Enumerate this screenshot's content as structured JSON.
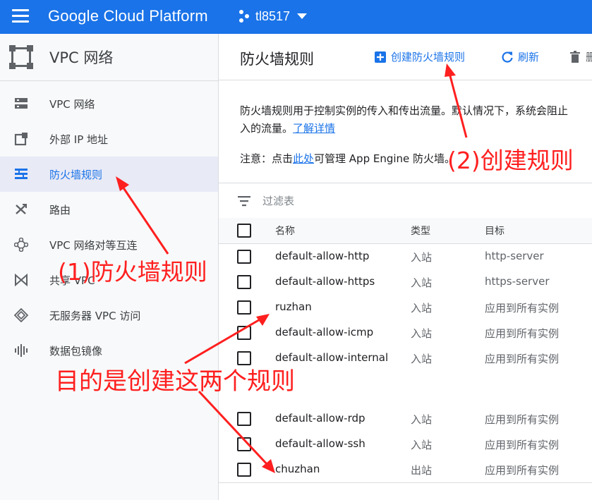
{
  "topbar": {
    "app_title": "Google Cloud Platform",
    "project_name": "tl8517",
    "color": "#1a73e8"
  },
  "sidebar": {
    "title": "VPC 网络",
    "items": [
      {
        "label": "VPC 网络",
        "icon": "vpc-network-icon",
        "active": false
      },
      {
        "label": "外部 IP 地址",
        "icon": "external-ip-icon",
        "active": false
      },
      {
        "label": "防火墙规则",
        "icon": "firewall-icon",
        "active": true
      },
      {
        "label": "路由",
        "icon": "routes-icon",
        "active": false
      },
      {
        "label": "VPC 网络对等互连",
        "icon": "peering-icon",
        "active": false
      },
      {
        "label": "共享 VPC",
        "icon": "shared-vpc-icon",
        "active": false
      },
      {
        "label": "无服务器 VPC 访问",
        "icon": "serverless-icon",
        "active": false
      },
      {
        "label": "数据包镜像",
        "icon": "packet-mirroring-icon",
        "active": false
      }
    ]
  },
  "main": {
    "page_title": "防火墙规则",
    "actions": {
      "create": "创建防火墙规则",
      "refresh": "刷新",
      "delete": "删"
    },
    "description_line1": "防火墙规则用于控制实例的传入和传出流量。默认情况下，系统会阻止",
    "description_line2": "入的流量。",
    "learn_more": "了解详情",
    "note_prefix": "注意：点击",
    "note_link": "此处",
    "note_suffix": "可管理 App Engine 防火墙。",
    "filter_placeholder": "过滤表",
    "table": {
      "headers": {
        "name": "名称",
        "type": "类型",
        "target": "目标"
      },
      "rows": [
        {
          "name": "default-allow-http",
          "type": "入站",
          "target": "http-server"
        },
        {
          "name": "default-allow-https",
          "type": "入站",
          "target": "https-server"
        },
        {
          "name": "ruzhan",
          "type": "入站",
          "target": "应用到所有实例"
        },
        {
          "name": "default-allow-icmp",
          "type": "入站",
          "target": "应用到所有实例"
        },
        {
          "name": "default-allow-internal",
          "type": "入站",
          "target": "应用到所有实例"
        },
        {
          "name": "default-allow-rdp",
          "type": "入站",
          "target": "应用到所有实例"
        },
        {
          "name": "default-allow-ssh",
          "type": "入站",
          "target": "应用到所有实例"
        },
        {
          "name": "chuzhan",
          "type": "出站",
          "target": "应用到所有实例"
        }
      ]
    }
  },
  "annotations": {
    "step1": "(1)防火墙规则",
    "step2": "(2)创建规则",
    "goal": "目的是创建这两个规则",
    "color": "#ff1f1f"
  }
}
